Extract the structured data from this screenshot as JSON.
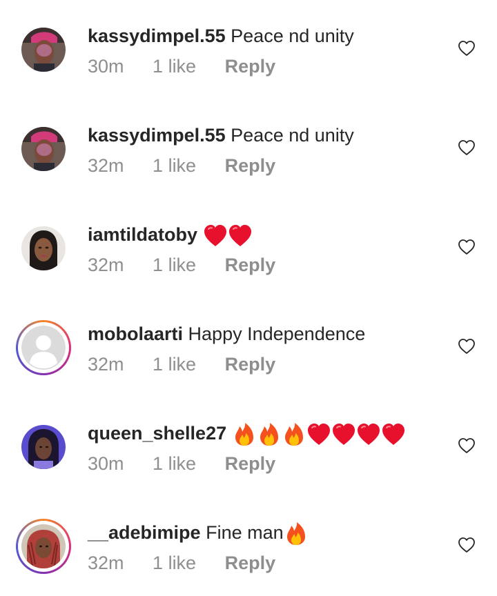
{
  "comments": [
    {
      "username": "kassydimpel.55",
      "text": "Peace nd unity",
      "time": "30m",
      "likes": "1 like",
      "reply": "Reply"
    },
    {
      "username": "kassydimpel.55",
      "text": "Peace nd unity",
      "time": "32m",
      "likes": "1 like",
      "reply": "Reply"
    },
    {
      "username": "iamtildatoby",
      "text": "",
      "time": "32m",
      "likes": "1 like",
      "reply": "Reply"
    },
    {
      "username": "mobolaarti",
      "text": "Happy Independence",
      "time": "32m",
      "likes": "1 like",
      "reply": "Reply"
    },
    {
      "username": "queen_shelle27",
      "text": "",
      "time": "30m",
      "likes": "1 like",
      "reply": "Reply"
    },
    {
      "username": "__adebimipe",
      "text": "Fine man",
      "time": "32m",
      "likes": "1 like",
      "reply": "Reply"
    }
  ],
  "icons": {
    "like": "heart-outline-icon",
    "emoji_heart": "red-heart-emoji",
    "emoji_fire": "fire-emoji"
  },
  "colors": {
    "text": "#262626",
    "meta": "#8e8e8e",
    "heart_emoji": "#e8112d",
    "fire_outer": "#f4511e",
    "fire_inner": "#ffc107"
  }
}
